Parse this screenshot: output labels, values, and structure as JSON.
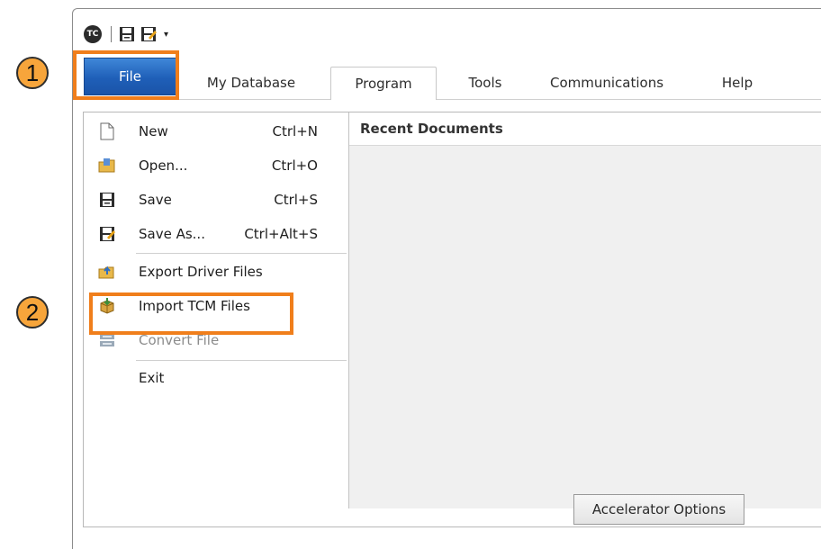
{
  "qat": {
    "logo_text": "TC",
    "icons": [
      "app-logo-icon",
      "save-icon",
      "save-as-icon",
      "customize-dropdown-icon"
    ],
    "dropdown_glyph": "▾"
  },
  "tabs": [
    {
      "label": "File",
      "state": "selected"
    },
    {
      "label": "My Database"
    },
    {
      "label": "Program",
      "state": "active"
    },
    {
      "label": "Tools"
    },
    {
      "label": "Communications"
    },
    {
      "label": "Help"
    }
  ],
  "file_menu": {
    "items": [
      {
        "label": "New",
        "shortcut": "Ctrl+N",
        "icon": "new-file-icon"
      },
      {
        "label": "Open...",
        "shortcut": "Ctrl+O",
        "icon": "open-folder-icon"
      },
      {
        "label": "Save",
        "shortcut": "Ctrl+S",
        "icon": "save-icon"
      },
      {
        "label": "Save As...",
        "shortcut": "Ctrl+Alt+S",
        "icon": "save-as-icon"
      },
      {
        "label": "Export Driver Files",
        "icon": "export-icon"
      },
      {
        "label": "Import TCM Files",
        "icon": "import-package-icon"
      },
      {
        "label": "Convert File",
        "icon": "convert-icon",
        "disabled": true
      },
      {
        "label": "Exit"
      }
    ]
  },
  "recent_documents": {
    "header": "Recent Documents"
  },
  "accelerator_button": {
    "label": "Accelerator Options"
  },
  "callouts": [
    {
      "number": "1"
    },
    {
      "number": "2"
    }
  ],
  "colors": {
    "highlight": "#f07e1b",
    "callout_fill": "#f7a53b",
    "file_tab": "#1f5fb8"
  }
}
